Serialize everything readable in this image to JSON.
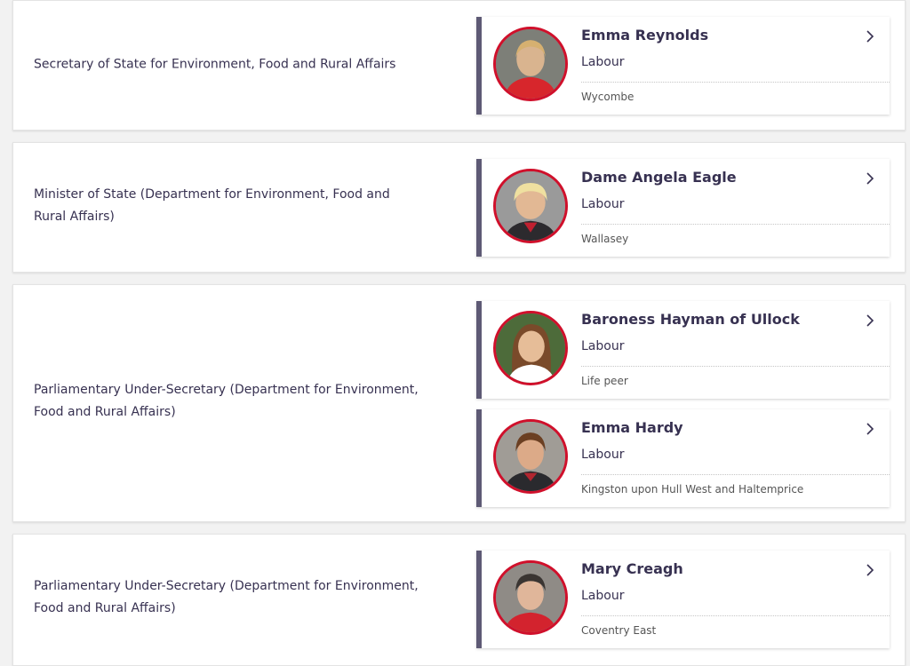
{
  "colors": {
    "accent_bar": "#5e5a75",
    "avatar_ring": "#d0102b",
    "text_primary": "#373151",
    "text_secondary": "#555555"
  },
  "roles": [
    {
      "title": "Secretary of State for Environment, Food and Rural Affairs",
      "members": [
        {
          "name": "Emma Reynolds",
          "party": "Labour",
          "constituency": "Wycombe",
          "icon": "chevron-right-icon"
        }
      ]
    },
    {
      "title": "Minister of State (Department for Environment, Food and Rural Affairs)",
      "members": [
        {
          "name": "Dame Angela Eagle",
          "party": "Labour",
          "constituency": "Wallasey",
          "icon": "chevron-right-icon"
        }
      ]
    },
    {
      "title": "Parliamentary Under-Secretary (Department for Environment, Food and Rural Affairs)",
      "members": [
        {
          "name": "Baroness Hayman of Ullock",
          "party": "Labour",
          "constituency": "Life peer",
          "icon": "chevron-right-icon"
        },
        {
          "name": "Emma Hardy",
          "party": "Labour",
          "constituency": "Kingston upon Hull West and Haltemprice",
          "icon": "chevron-right-icon"
        }
      ]
    },
    {
      "title": "Parliamentary Under-Secretary (Department for Environment, Food and Rural Affairs)",
      "members": [
        {
          "name": "Mary Creagh",
          "party": "Labour",
          "constituency": "Coventry East",
          "icon": "chevron-right-icon"
        }
      ]
    }
  ]
}
